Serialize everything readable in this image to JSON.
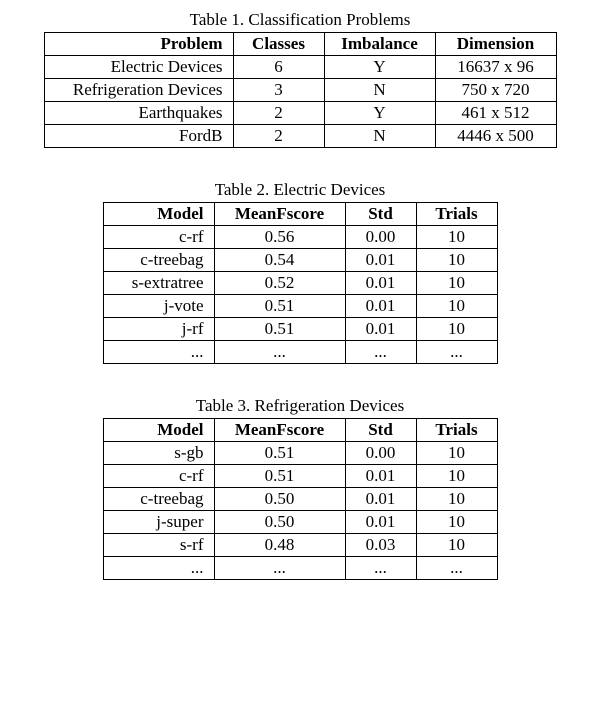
{
  "table1": {
    "caption": "Table 1.  Classification Problems",
    "headers": [
      "Problem",
      "Classes",
      "Imbalance",
      "Dimension"
    ],
    "rows": [
      [
        "Electric Devices",
        "6",
        "Y",
        "16637 x 96"
      ],
      [
        "Refrigeration Devices",
        "3",
        "N",
        "750 x 720"
      ],
      [
        "Earthquakes",
        "2",
        "Y",
        "461 x 512"
      ],
      [
        "FordB",
        "2",
        "N",
        "4446 x 500"
      ]
    ]
  },
  "table2": {
    "caption": "Table 2.  Electric Devices",
    "headers": [
      "Model",
      "MeanFscore",
      "Std",
      "Trials"
    ],
    "rows": [
      [
        "c-rf",
        "0.56",
        "0.00",
        "10"
      ],
      [
        "c-treebag",
        "0.54",
        "0.01",
        "10"
      ],
      [
        "s-extratree",
        "0.52",
        "0.01",
        "10"
      ],
      [
        "j-vote",
        "0.51",
        "0.01",
        "10"
      ],
      [
        "j-rf",
        "0.51",
        "0.01",
        "10"
      ],
      [
        "...",
        "...",
        "...",
        "..."
      ]
    ]
  },
  "table3": {
    "caption": "Table 3.  Refrigeration Devices",
    "headers": [
      "Model",
      "MeanFscore",
      "Std",
      "Trials"
    ],
    "rows": [
      [
        "s-gb",
        "0.51",
        "0.00",
        "10"
      ],
      [
        "c-rf",
        "0.51",
        "0.01",
        "10"
      ],
      [
        "c-treebag",
        "0.50",
        "0.01",
        "10"
      ],
      [
        "j-super",
        "0.50",
        "0.01",
        "10"
      ],
      [
        "s-rf",
        "0.48",
        "0.03",
        "10"
      ],
      [
        "...",
        "...",
        "...",
        "..."
      ]
    ]
  },
  "chart_data": [
    {
      "type": "table",
      "title": "Table 1. Classification Problems",
      "columns": [
        "Problem",
        "Classes",
        "Imbalance",
        "Dimension"
      ],
      "rows": [
        {
          "Problem": "Electric Devices",
          "Classes": 6,
          "Imbalance": "Y",
          "Dimension": "16637 x 96"
        },
        {
          "Problem": "Refrigeration Devices",
          "Classes": 3,
          "Imbalance": "N",
          "Dimension": "750 x 720"
        },
        {
          "Problem": "Earthquakes",
          "Classes": 2,
          "Imbalance": "Y",
          "Dimension": "461 x 512"
        },
        {
          "Problem": "FordB",
          "Classes": 2,
          "Imbalance": "N",
          "Dimension": "4446 x 500"
        }
      ]
    },
    {
      "type": "table",
      "title": "Table 2. Electric Devices",
      "columns": [
        "Model",
        "MeanFscore",
        "Std",
        "Trials"
      ],
      "rows": [
        {
          "Model": "c-rf",
          "MeanFscore": 0.56,
          "Std": 0.0,
          "Trials": 10
        },
        {
          "Model": "c-treebag",
          "MeanFscore": 0.54,
          "Std": 0.01,
          "Trials": 10
        },
        {
          "Model": "s-extratree",
          "MeanFscore": 0.52,
          "Std": 0.01,
          "Trials": 10
        },
        {
          "Model": "j-vote",
          "MeanFscore": 0.51,
          "Std": 0.01,
          "Trials": 10
        },
        {
          "Model": "j-rf",
          "MeanFscore": 0.51,
          "Std": 0.01,
          "Trials": 10
        }
      ]
    },
    {
      "type": "table",
      "title": "Table 3. Refrigeration Devices",
      "columns": [
        "Model",
        "MeanFscore",
        "Std",
        "Trials"
      ],
      "rows": [
        {
          "Model": "s-gb",
          "MeanFscore": 0.51,
          "Std": 0.0,
          "Trials": 10
        },
        {
          "Model": "c-rf",
          "MeanFscore": 0.51,
          "Std": 0.01,
          "Trials": 10
        },
        {
          "Model": "c-treebag",
          "MeanFscore": 0.5,
          "Std": 0.01,
          "Trials": 10
        },
        {
          "Model": "j-super",
          "MeanFscore": 0.5,
          "Std": 0.01,
          "Trials": 10
        },
        {
          "Model": "s-rf",
          "MeanFscore": 0.48,
          "Std": 0.03,
          "Trials": 10
        }
      ]
    }
  ]
}
